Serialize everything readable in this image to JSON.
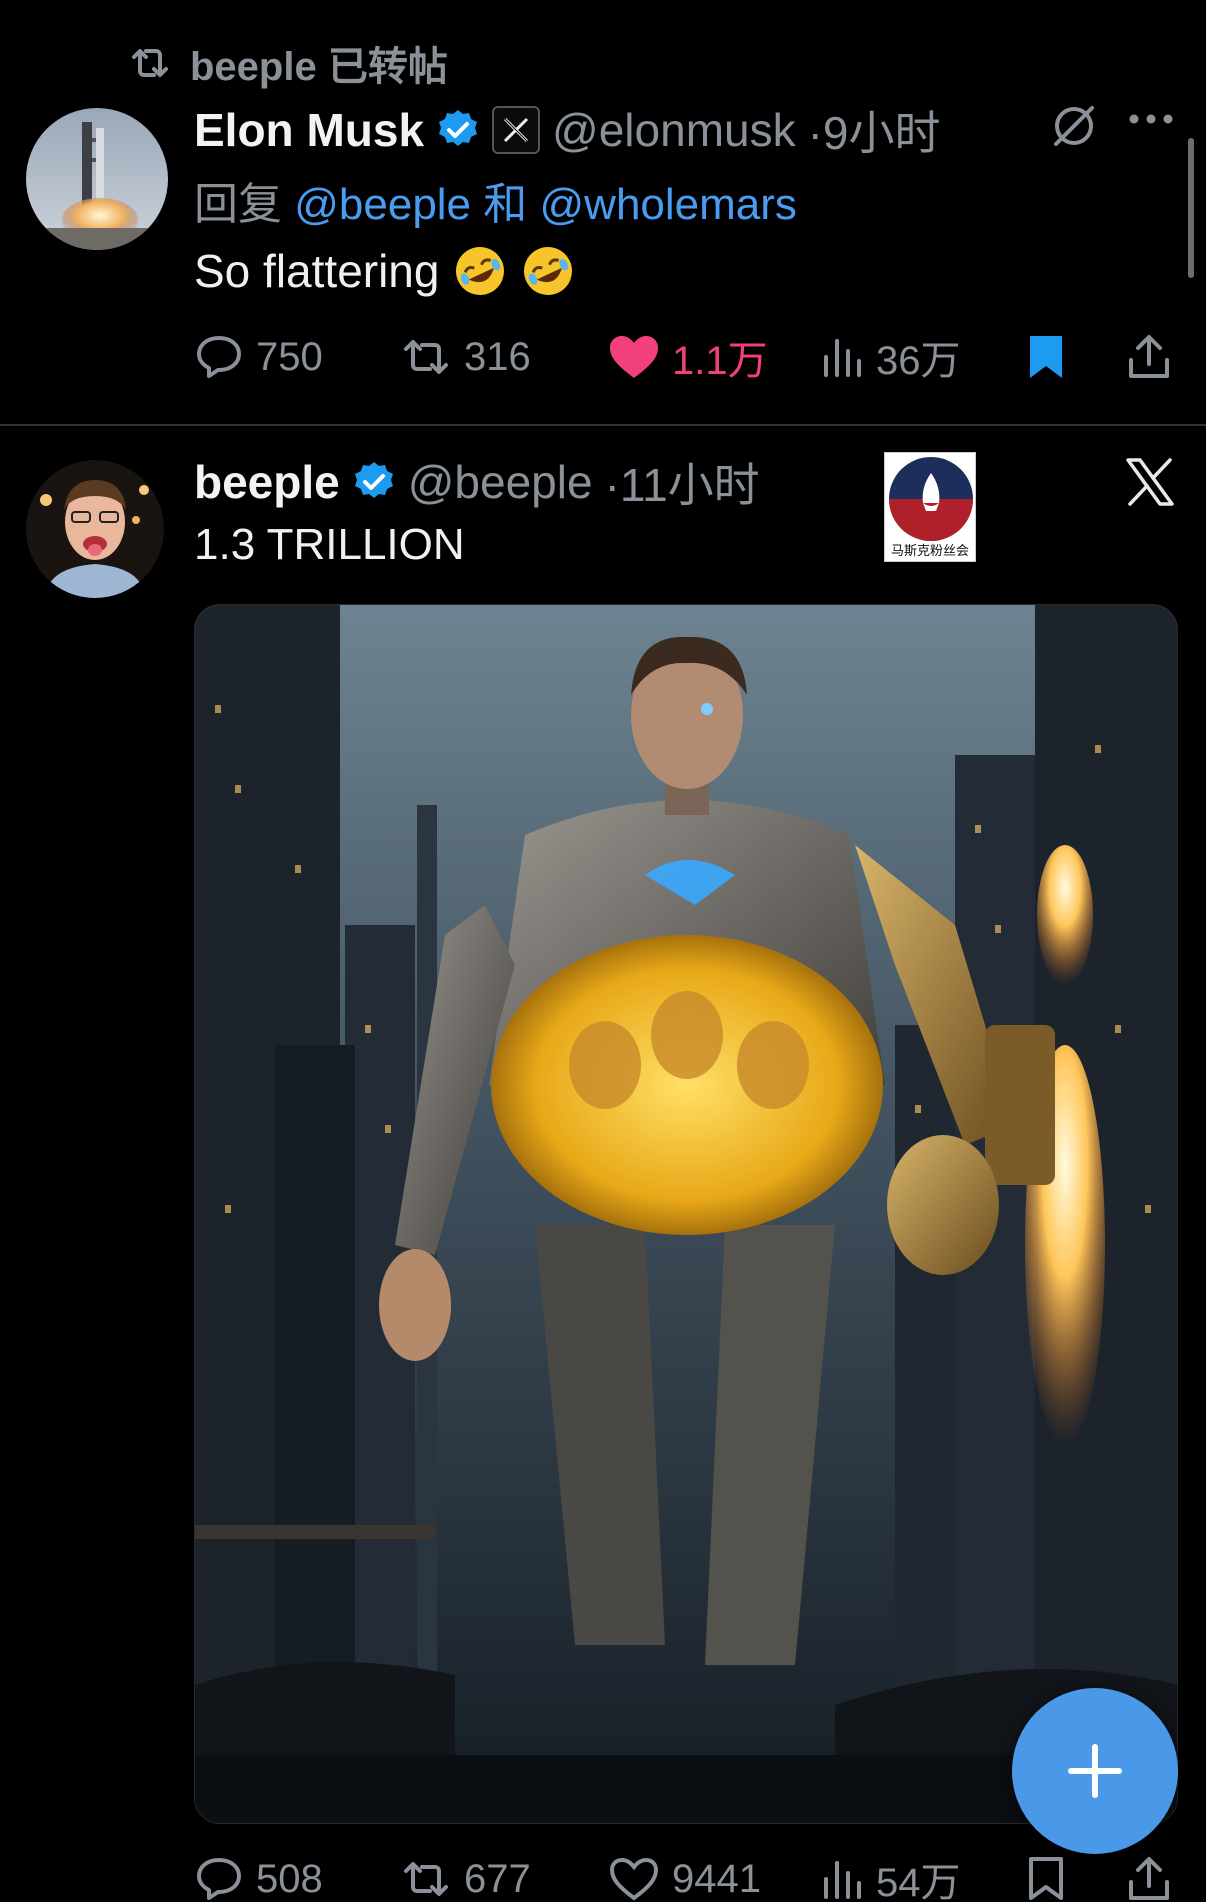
{
  "retweet": {
    "text": "beeple 已转帖"
  },
  "tweet1": {
    "author_name": "Elon Musk",
    "handle": "@elonmusk",
    "time": "·9小时",
    "reply_prefix": "回复",
    "reply_user1": "@beeple",
    "reply_and": "和",
    "reply_user2": "@wholemars",
    "text": "So flattering",
    "stats": {
      "replies": "750",
      "reposts": "316",
      "likes": "1.1万",
      "views": "36万"
    }
  },
  "tweet2": {
    "author_name": "beeple",
    "handle": "@beeple",
    "time": "·11小时",
    "text": "1.3 TRILLION",
    "watermark_label": "马斯克粉丝会",
    "stats": {
      "replies": "508",
      "reposts": "677",
      "likes": "9441",
      "views": "54万"
    }
  },
  "colors": {
    "background": "#000000",
    "muted": "#8b9199",
    "link": "#4a9cf0",
    "like": "#f23f7d",
    "verified": "#1d9bf0",
    "fab": "#4a99e9"
  },
  "icons": [
    "retweet-icon",
    "verified-badge-icon",
    "x-badge-icon",
    "grok-icon",
    "more-icon",
    "reply-icon",
    "repost-icon",
    "like-icon",
    "views-icon",
    "bookmark-icon",
    "share-icon",
    "x-logo-icon",
    "plus-icon"
  ]
}
